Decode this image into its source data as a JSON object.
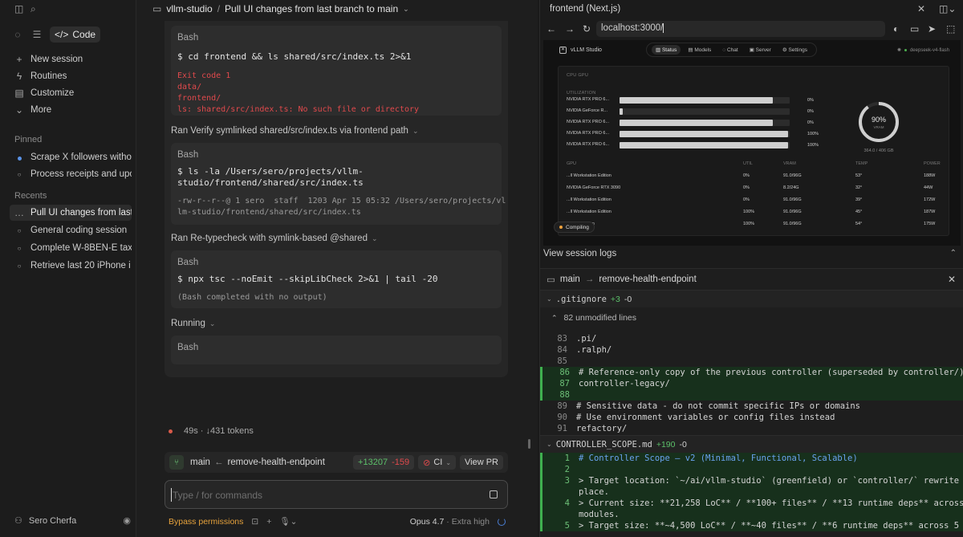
{
  "sidebar": {
    "modes": {
      "code_label": "Code"
    },
    "nav": [
      {
        "label": "New session",
        "icon": "plus-icon"
      },
      {
        "label": "Routines",
        "icon": "bolt-icon"
      },
      {
        "label": "Customize",
        "icon": "briefcase-icon"
      },
      {
        "label": "More",
        "icon": "more-icon"
      }
    ],
    "pinned_header": "Pinned",
    "pinned": [
      "Scrape X followers witho",
      "Process receipts and upo"
    ],
    "recents_header": "Recents",
    "recents": [
      "Pull UI changes from last",
      "General coding session",
      "Complete W-8BEN-E tax",
      "Retrieve last 20 iPhone i"
    ],
    "user": "Sero Cherfa"
  },
  "chat": {
    "project": "vllm-studio",
    "session_title": "Pull UI changes from last branch to main",
    "blocks": [
      {
        "label": "Bash",
        "command": "$ cd frontend && ls shared/src/index.ts 2>&1",
        "error_lines": [
          "Exit code 1",
          "data/",
          "frontend/",
          "ls: shared/src/index.ts: No such file or directory"
        ]
      },
      {
        "label": "Bash",
        "command": "$ ls -la /Users/sero/projects/vllm-\nstudio/frontend/shared/src/index.ts",
        "output": "-rw-r--r--@ 1 sero  staff  1203 Apr 15 05:32 /Users/sero/projects/vl\nlm-studio/frontend/shared/src/index.ts"
      },
      {
        "label": "Bash",
        "command": "$ npx tsc --noEmit --skipLibCheck 2>&1 | tail -20",
        "output": "(Bash completed with no output)"
      },
      {
        "label": "Bash"
      }
    ],
    "steps": [
      "Ran Verify symlinked shared/src/index.ts via frontend path",
      "Ran Re-typecheck with symlink-based @shared",
      "Running"
    ],
    "status_time": "49s",
    "status_tokens": "↓431 tokens",
    "branch": {
      "base": "main",
      "arrow": "←",
      "head": "remove-health-endpoint",
      "additions": "+13207",
      "deletions": "-159",
      "ci_label": "CI",
      "pr_label": "View PR"
    },
    "input_placeholder": "Type / for commands",
    "permission_label": "Bypass permissions",
    "model": "Opus 4.7",
    "effort": "· Extra high"
  },
  "browser": {
    "title": "frontend (Next.js)",
    "url": "localhost:3000/",
    "app_name": "vLLM Studio",
    "nav_tabs": [
      "Status",
      "Models",
      "Chat",
      "Server",
      "Settings"
    ],
    "active_tab": "Status",
    "model_badge": "deepseek-v4-flash",
    "section_label": "CPU GPU",
    "util_label": "UTILIZATION",
    "gpu_bars": [
      {
        "name": "NVIDIA RTX PRO 6...",
        "pct": "0%",
        "fill": 0.9
      },
      {
        "name": "NVIDIA GeForce R...",
        "pct": "0%",
        "fill": 0.02
      },
      {
        "name": "NVIDIA RTX PRO 6...",
        "pct": "0%",
        "fill": 0.9
      },
      {
        "name": "NVIDIA RTX PRO 6...",
        "pct": "100%",
        "fill": 0.99
      },
      {
        "name": "NVIDIA RTX PRO 6...",
        "pct": "100%",
        "fill": 0.99
      }
    ],
    "vram_pct": "90%",
    "vram_label": "VRAM",
    "vram_fraction": 0.9,
    "vram_used": "364.0 / 406 GB",
    "table_headers": [
      "GPU",
      "UTIL",
      "VRAM",
      "TEMP",
      "POWER"
    ],
    "table_rows": [
      [
        "...ll Workstation Edition",
        "0%",
        "91.0/96G",
        "53°",
        "188W"
      ],
      [
        "NVIDIA GeForce RTX 3090",
        "0%",
        "8.2/24G",
        "32°",
        "44W"
      ],
      [
        "...ll Workstation Edition",
        "0%",
        "91.0/96G",
        "39°",
        "172W"
      ],
      [
        "...ll Workstation Edition",
        "100%",
        "91.0/96G",
        "45°",
        "187W"
      ],
      [
        "...ation Edition",
        "100%",
        "91.0/96G",
        "54°",
        "175W"
      ]
    ],
    "compiling_label": "Compiling",
    "session_logs_label": "View session logs"
  },
  "diff": {
    "base": "main",
    "arrow": "→",
    "head": "remove-health-endpoint",
    "files": [
      {
        "name": ".gitignore",
        "additions": "+3",
        "deletions": "-0"
      },
      {
        "name": "CONTROLLER_SCOPE.md",
        "additions": "+190",
        "deletions": "-0"
      }
    ],
    "unmodified_label": "82 unmodified lines",
    "gitignore_lines": [
      {
        "n": "83",
        "t": ".pi/",
        "kind": "ctx"
      },
      {
        "n": "84",
        "t": ".ralph/",
        "kind": "ctx"
      },
      {
        "n": "85",
        "t": "",
        "kind": "ctx"
      },
      {
        "n": "86",
        "t": "# Reference-only copy of the previous controller (superseded by controller/)",
        "kind": "plus"
      },
      {
        "n": "87",
        "t": "controller-legacy/",
        "kind": "plus"
      },
      {
        "n": "88",
        "t": "",
        "kind": "plus"
      },
      {
        "n": "89",
        "t": "# Sensitive data - do not commit specific IPs or domains",
        "kind": "ctx"
      },
      {
        "n": "90",
        "t": "# Use environment variables or config files instead",
        "kind": "ctx"
      },
      {
        "n": "91",
        "t": "refactory/",
        "kind": "ctx"
      }
    ],
    "scope_lines": [
      {
        "n": "1",
        "t": "# Controller Scope — v2 (Minimal, Functional, Scalable)",
        "kind": "plus blue"
      },
      {
        "n": "2",
        "t": "",
        "kind": "plus"
      },
      {
        "n": "3",
        "t": "> Target location: `~/ai/vllm-studio` (greenfield) or `controller/` rewrite in-",
        "kind": "plus"
      },
      {
        "n": "",
        "t": "place.",
        "kind": "plus"
      },
      {
        "n": "4",
        "t": "> Current size: **21,258 LoC** / **100+ files** / **13 runtime deps** across 8",
        "kind": "plus"
      },
      {
        "n": "",
        "t": "modules.",
        "kind": "plus"
      },
      {
        "n": "5",
        "t": "> Target size: **~4,500 LoC** / **~40 files** / **6 runtime deps** across 5",
        "kind": "plus"
      }
    ]
  }
}
